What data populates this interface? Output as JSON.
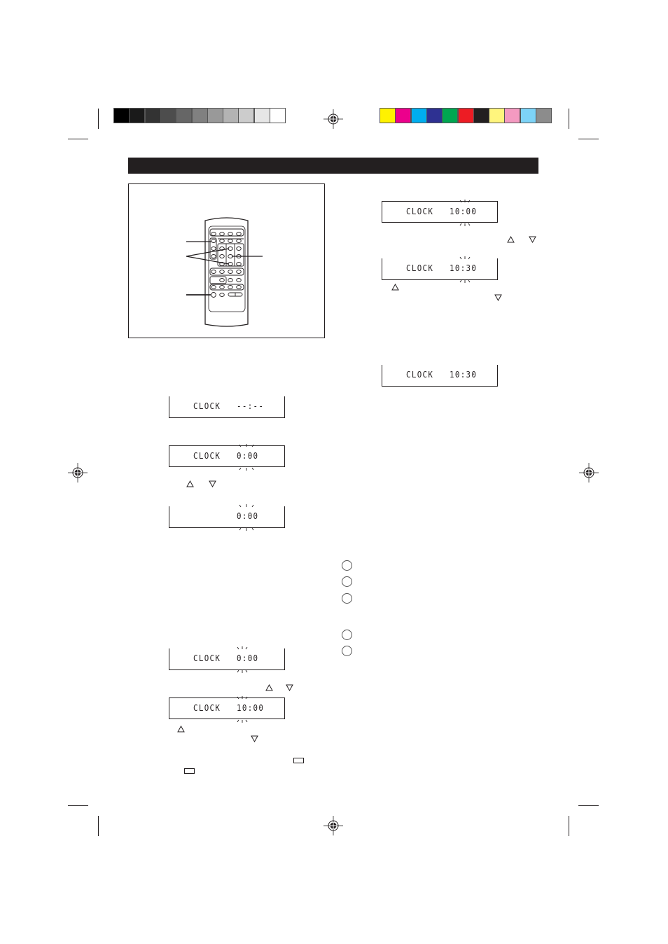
{
  "page": {
    "header_bar_text": "",
    "grey_scale_swatches": [
      "#000000",
      "#1a1a1a",
      "#333333",
      "#4d4d4d",
      "#666666",
      "#808080",
      "#999999",
      "#b3b3b3",
      "#cccccc",
      "#e6e6e6",
      "#ffffff"
    ],
    "color_swatches": [
      "#fff200",
      "#ec008c",
      "#00aeef",
      "#2e3192",
      "#00a651",
      "#ed1c24",
      "#231f20",
      "#fff57d",
      "#f49ac1",
      "#7dd3f7",
      "#8c8c8c"
    ]
  },
  "left_column": {
    "figure": {
      "name": "remote-control-illustration",
      "callouts": 3
    },
    "displays": [
      {
        "label": "CLOCK",
        "time": "--:--",
        "blinking": false
      },
      {
        "label": "CLOCK",
        "time": "0:00",
        "blinking": true
      },
      {
        "label": "",
        "time": "0:00",
        "blinking": true
      },
      {
        "label": "CLOCK",
        "time": "0:00",
        "blinking": true
      },
      {
        "label": "CLOCK",
        "time": "10:00",
        "blinking": true
      }
    ]
  },
  "right_column": {
    "displays": [
      {
        "label": "CLOCK",
        "time": "10:00",
        "blinking": true
      },
      {
        "label": "CLOCK",
        "time": "10:30",
        "blinking": true
      },
      {
        "label": "CLOCK",
        "time": "10:30",
        "blinking": false
      }
    ],
    "numbered_circles": 5
  },
  "icons": {
    "up": "up-triangle-icon",
    "down": "down-triangle-icon"
  }
}
